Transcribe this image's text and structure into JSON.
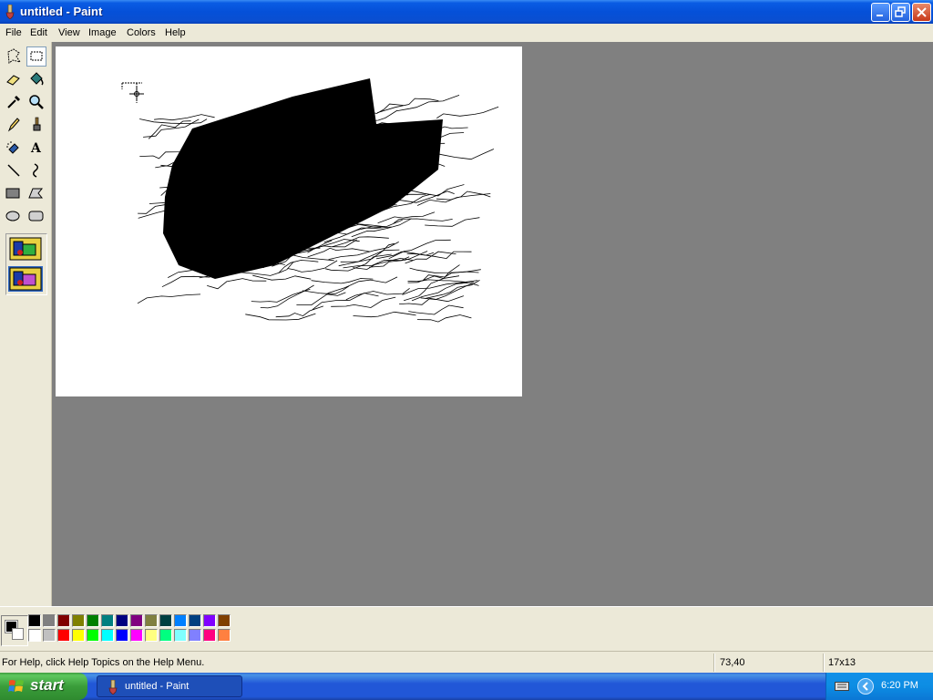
{
  "window": {
    "title": "untitled - Paint"
  },
  "menu": [
    "File",
    "Edit",
    "View",
    "Image",
    "Colors",
    "Help"
  ],
  "tools": [
    {
      "name": "free-form-select",
      "icon": "free-form-select-icon"
    },
    {
      "name": "select",
      "icon": "rectangle-select-icon",
      "selected": true
    },
    {
      "name": "eraser",
      "icon": "eraser-icon"
    },
    {
      "name": "fill-with-color",
      "icon": "paint-bucket-icon"
    },
    {
      "name": "pick-color",
      "icon": "eyedropper-icon"
    },
    {
      "name": "magnifier",
      "icon": "magnifier-icon"
    },
    {
      "name": "pencil",
      "icon": "pencil-icon"
    },
    {
      "name": "brush",
      "icon": "brush-icon"
    },
    {
      "name": "airbrush",
      "icon": "airbrush-icon"
    },
    {
      "name": "text",
      "icon": "text-tool-icon"
    },
    {
      "name": "line",
      "icon": "line-icon"
    },
    {
      "name": "curve",
      "icon": "curve-icon"
    },
    {
      "name": "rectangle",
      "icon": "rectangle-icon"
    },
    {
      "name": "polygon",
      "icon": "polygon-icon"
    },
    {
      "name": "ellipse",
      "icon": "ellipse-icon"
    },
    {
      "name": "rounded-rectangle",
      "icon": "rounded-rectangle-icon"
    }
  ],
  "palette": {
    "foreground": "#000000",
    "background": "#ffffff",
    "row1": [
      "#000000",
      "#808080",
      "#800000",
      "#808000",
      "#008000",
      "#008080",
      "#000080",
      "#800080",
      "#808040",
      "#004040",
      "#0080ff",
      "#004080",
      "#8000ff",
      "#804000"
    ],
    "row2": [
      "#ffffff",
      "#c0c0c0",
      "#ff0000",
      "#ffff00",
      "#00ff00",
      "#00ffff",
      "#0000ff",
      "#ff00ff",
      "#ffff80",
      "#00ff80",
      "#80ffff",
      "#8080ff",
      "#ff0080",
      "#ff8040"
    ]
  },
  "status": {
    "help_text": "For Help, click Help Topics on the Help Menu.",
    "coords": "73,40",
    "size": "17x13"
  },
  "taskbar": {
    "start_label": "start",
    "task_label": "untitled - Paint",
    "clock": "6:20 PM"
  }
}
